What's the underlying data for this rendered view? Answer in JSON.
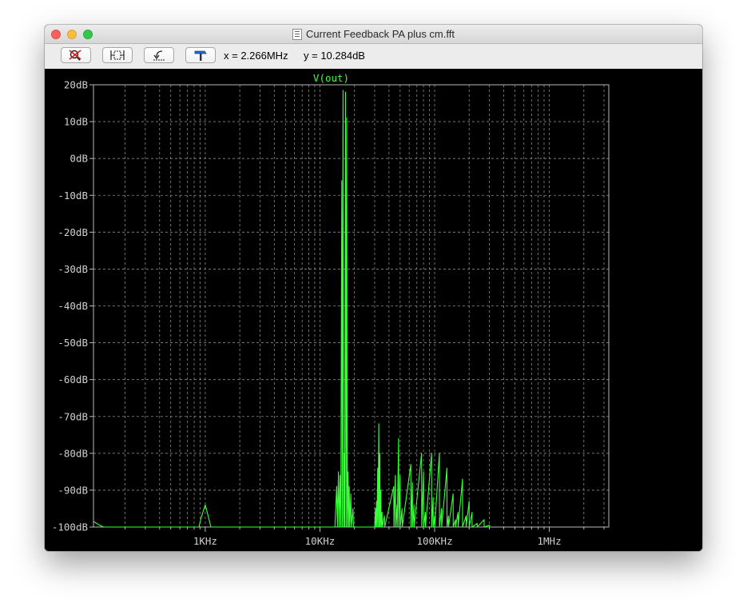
{
  "window": {
    "title": "Current Feedback PA plus cm.fft"
  },
  "toolbar": {
    "buttons": [
      {
        "name": "zoom-clear-button",
        "icon": "magnifier-cross-icon"
      },
      {
        "name": "zoom-extents-button",
        "icon": "zoom-extents-icon"
      },
      {
        "name": "zoom-back-button",
        "icon": "zoom-back-icon"
      },
      {
        "name": "autorange-button",
        "icon": "hammer-icon"
      }
    ],
    "cursor_x": "x = 2.266MHz",
    "cursor_y": "y = 10.284dB"
  },
  "colors": {
    "background": "#000000",
    "trace": "#3bff3b",
    "grid": "#8a8a8a",
    "axis_text": "#cfcfcf"
  },
  "chart_data": {
    "type": "line",
    "title": "",
    "xlabel": "",
    "ylabel": "",
    "x_scale": "log",
    "xlim": [
      106,
      3300000
    ],
    "ylim": [
      -100,
      20
    ],
    "grid": true,
    "trace_name": "V(out)",
    "y_ticks": [
      {
        "value": 20,
        "label": "20dB"
      },
      {
        "value": 10,
        "label": "10dB"
      },
      {
        "value": 0,
        "label": "0dB"
      },
      {
        "value": -10,
        "label": "-10dB"
      },
      {
        "value": -20,
        "label": "-20dB"
      },
      {
        "value": -30,
        "label": "-30dB"
      },
      {
        "value": -40,
        "label": "-40dB"
      },
      {
        "value": -50,
        "label": "-50dB"
      },
      {
        "value": -60,
        "label": "-60dB"
      },
      {
        "value": -70,
        "label": "-70dB"
      },
      {
        "value": -80,
        "label": "-80dB"
      },
      {
        "value": -90,
        "label": "-90dB"
      },
      {
        "value": -100,
        "label": "-100dB"
      }
    ],
    "x_ticks": [
      {
        "value": 1000,
        "label": "1KHz"
      },
      {
        "value": 10000,
        "label": "10KHz"
      },
      {
        "value": 100000,
        "label": "100KHz"
      },
      {
        "value": 1000000,
        "label": "1MHz"
      }
    ],
    "series": [
      {
        "name": "V(out)",
        "points": [
          [
            106,
            -98.5
          ],
          [
            110,
            -98.8
          ],
          [
            120,
            -99.5
          ],
          [
            130,
            -100
          ],
          [
            880,
            -100
          ],
          [
            930,
            -97
          ],
          [
            1000,
            -94
          ],
          [
            1060,
            -97
          ],
          [
            1120,
            -100
          ],
          [
            13500,
            -100
          ],
          [
            14000,
            -89
          ],
          [
            14200,
            -100
          ],
          [
            14500,
            -85
          ],
          [
            14700,
            -100
          ],
          [
            15000,
            -86
          ],
          [
            15200,
            -100
          ],
          [
            15500,
            -6
          ],
          [
            15650,
            -100
          ],
          [
            15900,
            18.5
          ],
          [
            16100,
            -100
          ],
          [
            16300,
            -80
          ],
          [
            16450,
            -100
          ],
          [
            16700,
            18
          ],
          [
            16900,
            -100
          ],
          [
            17100,
            11
          ],
          [
            17300,
            -100
          ],
          [
            17600,
            -85
          ],
          [
            17800,
            -100
          ],
          [
            18000,
            -89
          ],
          [
            18200,
            -100
          ],
          [
            18600,
            -91
          ],
          [
            18800,
            -100
          ],
          [
            19400,
            -95
          ],
          [
            19600,
            -100
          ],
          [
            30000,
            -100
          ],
          [
            30500,
            -95
          ],
          [
            30700,
            -100
          ],
          [
            31200,
            -93
          ],
          [
            31400,
            -100
          ],
          [
            31900,
            -84
          ],
          [
            32100,
            -100
          ],
          [
            32600,
            -72
          ],
          [
            32800,
            -100
          ],
          [
            33300,
            -80
          ],
          [
            33500,
            -100
          ],
          [
            34000,
            -90
          ],
          [
            34200,
            -100
          ],
          [
            34800,
            -96
          ],
          [
            35000,
            -100
          ],
          [
            36500,
            -97
          ],
          [
            36700,
            -100
          ],
          [
            44000,
            -89
          ],
          [
            44200,
            -100
          ],
          [
            45500,
            -86
          ],
          [
            45700,
            -100
          ],
          [
            47000,
            -94
          ],
          [
            47200,
            -100
          ],
          [
            48500,
            -76
          ],
          [
            48700,
            -100
          ],
          [
            50000,
            -86
          ],
          [
            50200,
            -100
          ],
          [
            52000,
            -95
          ],
          [
            52200,
            -100
          ],
          [
            62000,
            -83
          ],
          [
            62200,
            -100
          ],
          [
            64000,
            -88
          ],
          [
            64200,
            -100
          ],
          [
            66000,
            -94
          ],
          [
            66200,
            -100
          ],
          [
            77000,
            -80
          ],
          [
            77200,
            -100
          ],
          [
            80000,
            -85
          ],
          [
            80200,
            -100
          ],
          [
            83000,
            -96
          ],
          [
            83200,
            -100
          ],
          [
            94000,
            -80
          ],
          [
            94200,
            -100
          ],
          [
            97000,
            -92
          ],
          [
            97200,
            -100
          ],
          [
            100000,
            -97
          ],
          [
            100200,
            -100
          ],
          [
            110000,
            -80
          ],
          [
            110200,
            -100
          ],
          [
            115000,
            -95
          ],
          [
            115200,
            -100
          ],
          [
            128000,
            -84
          ],
          [
            128200,
            -100
          ],
          [
            132000,
            -97
          ],
          [
            132200,
            -100
          ],
          [
            145000,
            -91
          ],
          [
            145200,
            -100
          ],
          [
            152000,
            -98
          ],
          [
            152200,
            -100
          ],
          [
            160000,
            -96
          ],
          [
            160200,
            -100
          ],
          [
            175000,
            -87
          ],
          [
            175200,
            -100
          ],
          [
            188000,
            -97
          ],
          [
            188200,
            -100
          ],
          [
            200000,
            -93
          ],
          [
            200200,
            -100
          ],
          [
            212000,
            -96
          ],
          [
            212200,
            -100
          ],
          [
            235000,
            -99
          ],
          [
            235200,
            -100
          ],
          [
            270000,
            -98
          ],
          [
            270200,
            -100
          ],
          [
            300000,
            -99.5
          ],
          [
            300200,
            -100
          ]
        ]
      }
    ]
  }
}
